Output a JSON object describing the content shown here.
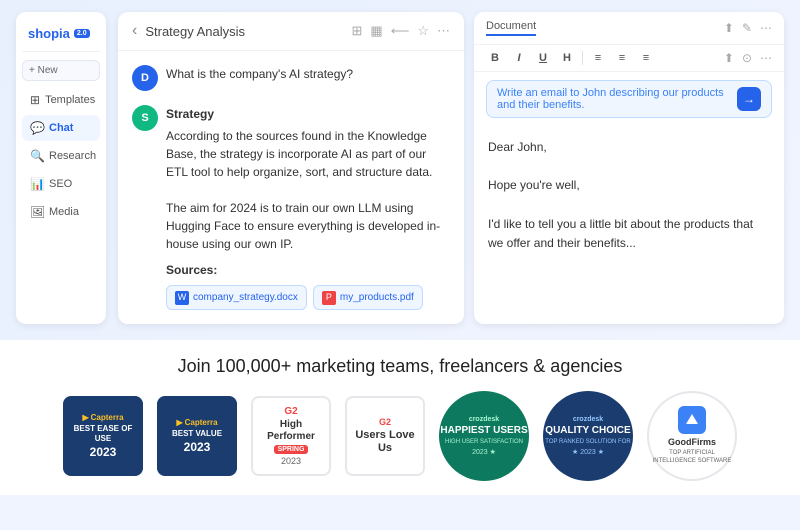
{
  "app": {
    "logo": "shopia",
    "logo_badge": "2.0",
    "new_button": "+ New"
  },
  "sidebar": {
    "items": [
      {
        "id": "templates",
        "label": "Templates",
        "icon": "⊞"
      },
      {
        "id": "chat",
        "label": "Chat",
        "icon": "💬",
        "active": true
      },
      {
        "id": "research",
        "label": "Research",
        "icon": "🔍"
      },
      {
        "id": "seo",
        "label": "SEO",
        "icon": "📊"
      },
      {
        "id": "media",
        "label": "Media",
        "icon": "🖼"
      }
    ]
  },
  "chat": {
    "title": "Strategy Analysis",
    "question": "What is the company's AI strategy?",
    "user_avatar": "D",
    "ai_avatar": "S",
    "ai_response_title": "Strategy",
    "ai_response_body": "According to the sources found in the Knowledge Base, the strategy is incorporate AI as part of our ETL tool to help organize, sort, and structure data.\n\nThe aim for 2024 is to train our own LLM using Hugging Face to ensure everything is developed in-house using our own IP.",
    "sources_label": "Sources:",
    "source1_name": "company_strategy.docx",
    "source2_name": "my_products.pdf"
  },
  "document": {
    "tab_label": "Document",
    "prompt_text": "Write an email to John describing our products and their benefits.",
    "send_icon": "→",
    "content_line1": "Dear John,",
    "content_line2": "Hope you're well,",
    "content_line3": "I'd like to tell you a little bit about the products that we offer and their benefits..."
  },
  "marketing": {
    "join_text": "Join 100,000+ marketing teams, freelancers & agencies"
  },
  "badges": [
    {
      "id": "capterra-ease",
      "type": "capterra",
      "line1": "BEST EASE OF USE",
      "year": "2023"
    },
    {
      "id": "capterra-value",
      "type": "capterra",
      "line1": "BEST VALUE",
      "year": "2023"
    },
    {
      "id": "g2-performer",
      "type": "g2",
      "main": "High Performer",
      "sub": "SPRING",
      "year": "2023"
    },
    {
      "id": "g2-users",
      "type": "g2-users",
      "main": "Users Love Us"
    },
    {
      "id": "crozdesk-happiest",
      "type": "crozdesk-green",
      "logo": "crozdesk",
      "main": "HAPPIEST USERS",
      "sub": "HIGH USER SATISFACTION",
      "year": "2023 ★"
    },
    {
      "id": "crozdesk-quality",
      "type": "crozdesk-blue",
      "logo": "crozdesk",
      "main": "QUALITY CHOICE",
      "sub": "TOP RANKED SOLUTION FOR",
      "year": "★ 2023 ★"
    },
    {
      "id": "goodfirms",
      "type": "goodfirms",
      "name": "GoodFirms",
      "sub": "TOP ARTIFICIAL\nINTELLIGENCE SOFTWARE"
    }
  ]
}
